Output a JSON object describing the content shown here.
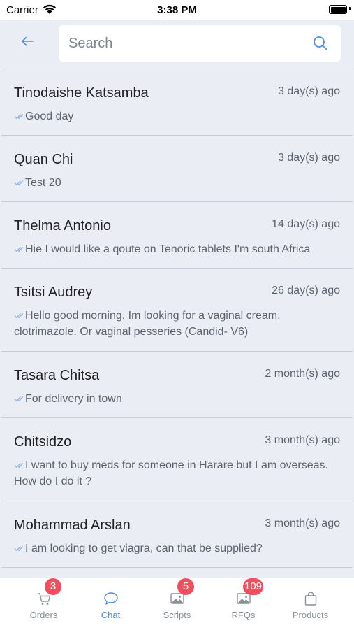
{
  "status_bar": {
    "carrier": "Carrier",
    "time": "3:38 PM"
  },
  "search": {
    "placeholder": "Search",
    "value": ""
  },
  "conversations": [
    {
      "name": "Tinodaishe Katsamba",
      "time_ago": "3 day(s) ago",
      "message": "Good day"
    },
    {
      "name": "Quan Chi",
      "time_ago": "3 day(s) ago",
      "message": "Test 20"
    },
    {
      "name": "Thelma Antonio",
      "time_ago": "14 day(s) ago",
      "message": "Hie I would like a qoute on Tenoric tablets I'm south Africa"
    },
    {
      "name": "Tsitsi Audrey",
      "time_ago": "26 day(s) ago",
      "message": "Hello good morning. Im looking for a vaginal cream, clotrimazole. Or vaginal pesseries (Candid- V6)"
    },
    {
      "name": "Tasara Chitsa",
      "time_ago": "2 month(s) ago",
      "message": "For delivery in town"
    },
    {
      "name": "Chitsidzo",
      "time_ago": "3 month(s) ago",
      "message": "I want to buy meds for someone in Harare but I am overseas. How do I do it ?"
    },
    {
      "name": "Mohammad Arslan",
      "time_ago": "3 month(s) ago",
      "message": "I am looking to get viagra, can that be supplied?"
    }
  ],
  "tabs": [
    {
      "label": "Orders",
      "icon": "cart-icon",
      "badge": "3"
    },
    {
      "label": "Chat",
      "icon": "chat-bubble-icon",
      "badge": ""
    },
    {
      "label": "Scripts",
      "icon": "image-icon",
      "badge": "5"
    },
    {
      "label": "RFQs",
      "icon": "image-icon",
      "badge": "109"
    },
    {
      "label": "Products",
      "icon": "shopping-bag-icon",
      "badge": ""
    }
  ],
  "colors": {
    "accent": "#4a90e2",
    "badge": "#f04f5d",
    "background": "#ebedf5"
  }
}
